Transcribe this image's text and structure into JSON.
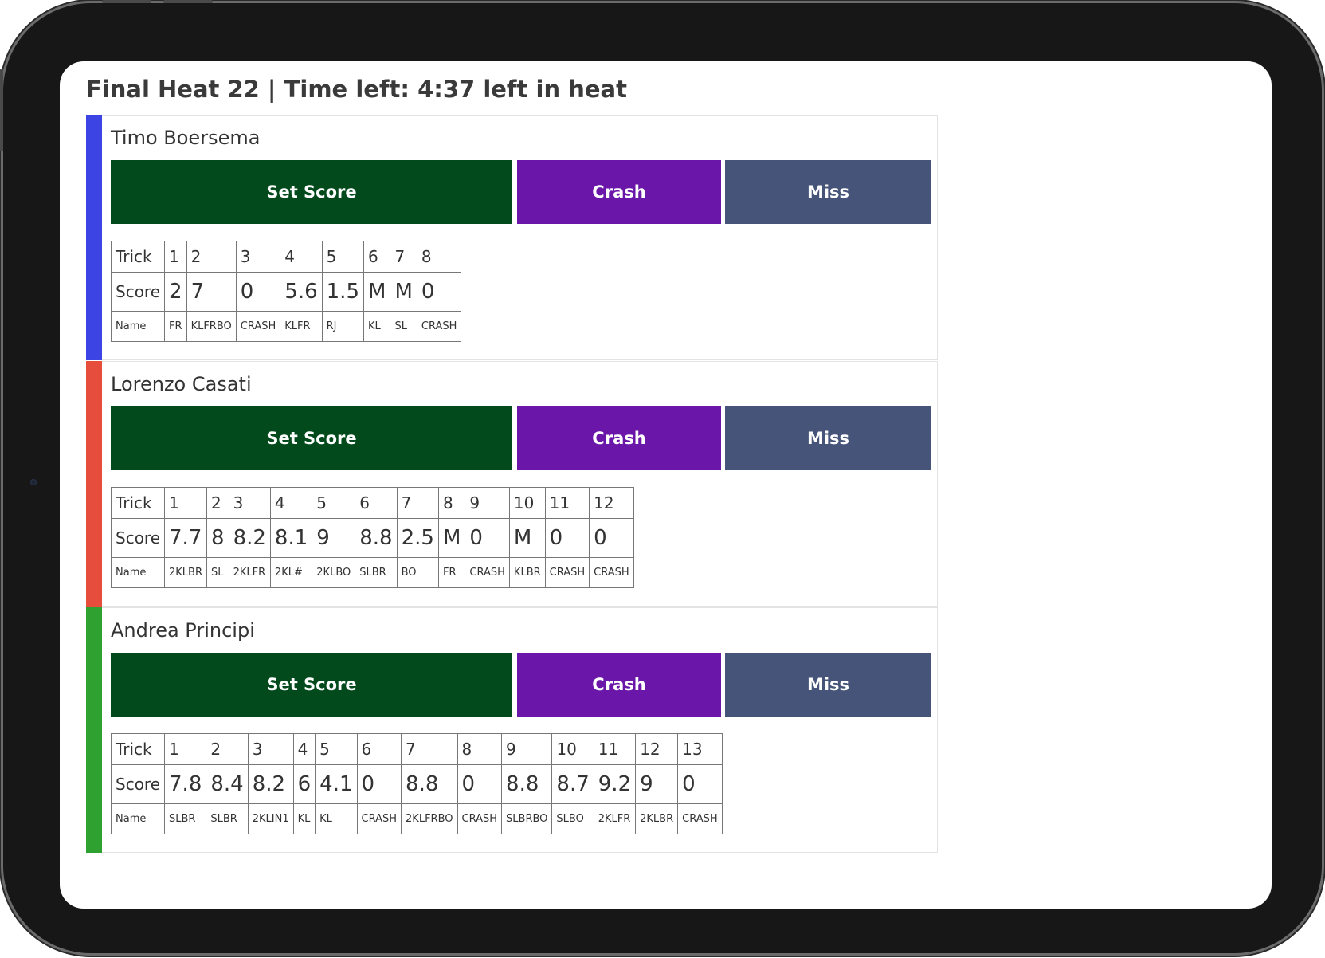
{
  "page": {
    "title": "Final Heat 22 | Time left: 4:37 left in heat"
  },
  "labels": {
    "trick": "Trick",
    "score": "Score",
    "name": "Name"
  },
  "colors": {
    "set_score": "#024a1b",
    "crash": "#6a17a9",
    "miss": "#455478"
  },
  "riders": [
    {
      "name": "Timo Boersema",
      "color": "#3c44e4",
      "buttons": {
        "set_score": "Set Score",
        "crash": "Crash",
        "miss": "Miss"
      },
      "tricks": [
        {
          "n": "1",
          "score": "2",
          "name": "FR"
        },
        {
          "n": "2",
          "score": "7",
          "name": "KLFRBO"
        },
        {
          "n": "3",
          "score": "0",
          "name": "CRASH"
        },
        {
          "n": "4",
          "score": "5.6",
          "name": "KLFR"
        },
        {
          "n": "5",
          "score": "1.5",
          "name": "RJ"
        },
        {
          "n": "6",
          "score": "M",
          "name": "KL"
        },
        {
          "n": "7",
          "score": "M",
          "name": "SL"
        },
        {
          "n": "8",
          "score": "0",
          "name": "CRASH"
        }
      ]
    },
    {
      "name": "Lorenzo Casati",
      "color": "#e64d3c",
      "buttons": {
        "set_score": "Set Score",
        "crash": "Crash",
        "miss": "Miss"
      },
      "tricks": [
        {
          "n": "1",
          "score": "7.7",
          "name": "2KLBR"
        },
        {
          "n": "2",
          "score": "8",
          "name": "SL"
        },
        {
          "n": "3",
          "score": "8.2",
          "name": "2KLFR"
        },
        {
          "n": "4",
          "score": "8.1",
          "name": "2KL#"
        },
        {
          "n": "5",
          "score": "9",
          "name": "2KLBO"
        },
        {
          "n": "6",
          "score": "8.8",
          "name": "SLBR"
        },
        {
          "n": "7",
          "score": "2.5",
          "name": "BO"
        },
        {
          "n": "8",
          "score": "M",
          "name": "FR"
        },
        {
          "n": "9",
          "score": "0",
          "name": "CRASH"
        },
        {
          "n": "10",
          "score": "M",
          "name": "KLBR"
        },
        {
          "n": "11",
          "score": "0",
          "name": "CRASH"
        },
        {
          "n": "12",
          "score": "0",
          "name": "CRASH"
        }
      ]
    },
    {
      "name": "Andrea Principi",
      "color": "#2ea131",
      "buttons": {
        "set_score": "Set Score",
        "crash": "Crash",
        "miss": "Miss"
      },
      "tricks": [
        {
          "n": "1",
          "score": "7.8",
          "name": "SLBR"
        },
        {
          "n": "2",
          "score": "8.4",
          "name": "SLBR"
        },
        {
          "n": "3",
          "score": "8.2",
          "name": "2KLIN1"
        },
        {
          "n": "4",
          "score": "6",
          "name": "KL"
        },
        {
          "n": "5",
          "score": "4.1",
          "name": "KL"
        },
        {
          "n": "6",
          "score": "0",
          "name": "CRASH"
        },
        {
          "n": "7",
          "score": "8.8",
          "name": "2KLFRBO"
        },
        {
          "n": "8",
          "score": "0",
          "name": "CRASH"
        },
        {
          "n": "9",
          "score": "8.8",
          "name": "SLBRBO"
        },
        {
          "n": "10",
          "score": "8.7",
          "name": "SLBO"
        },
        {
          "n": "11",
          "score": "9.2",
          "name": "2KLFR"
        },
        {
          "n": "12",
          "score": "9",
          "name": "2KLBR"
        },
        {
          "n": "13",
          "score": "0",
          "name": "CRASH"
        }
      ]
    }
  ]
}
